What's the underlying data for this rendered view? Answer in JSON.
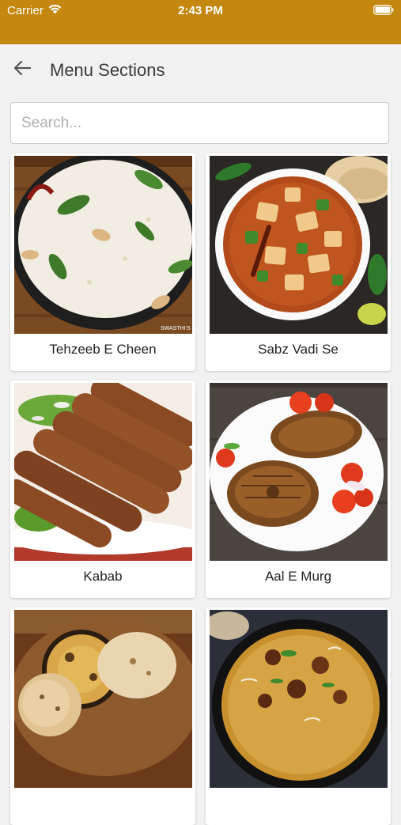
{
  "status_bar": {
    "carrier": "Carrier",
    "time": "2:43 PM",
    "wifi_icon": "wifi-icon",
    "battery_icon": "battery-icon",
    "bg_color": "#c4870f"
  },
  "header": {
    "title": "Menu Sections",
    "back_icon": "arrow-left-icon"
  },
  "search": {
    "placeholder": "Search...",
    "value": ""
  },
  "sections": [
    {
      "label": "Tehzeeb E Cheen",
      "image": "rice-dish"
    },
    {
      "label": "Sabz Vadi Se",
      "image": "paneer-curry"
    },
    {
      "label": "Kabab",
      "image": "seekh-kabab"
    },
    {
      "label": "Aal E Murg",
      "image": "grilled-fish"
    },
    {
      "label": "",
      "image": "flatbreads"
    },
    {
      "label": "",
      "image": "biryani"
    }
  ],
  "image_overlay_text": "SWASTHI'S"
}
